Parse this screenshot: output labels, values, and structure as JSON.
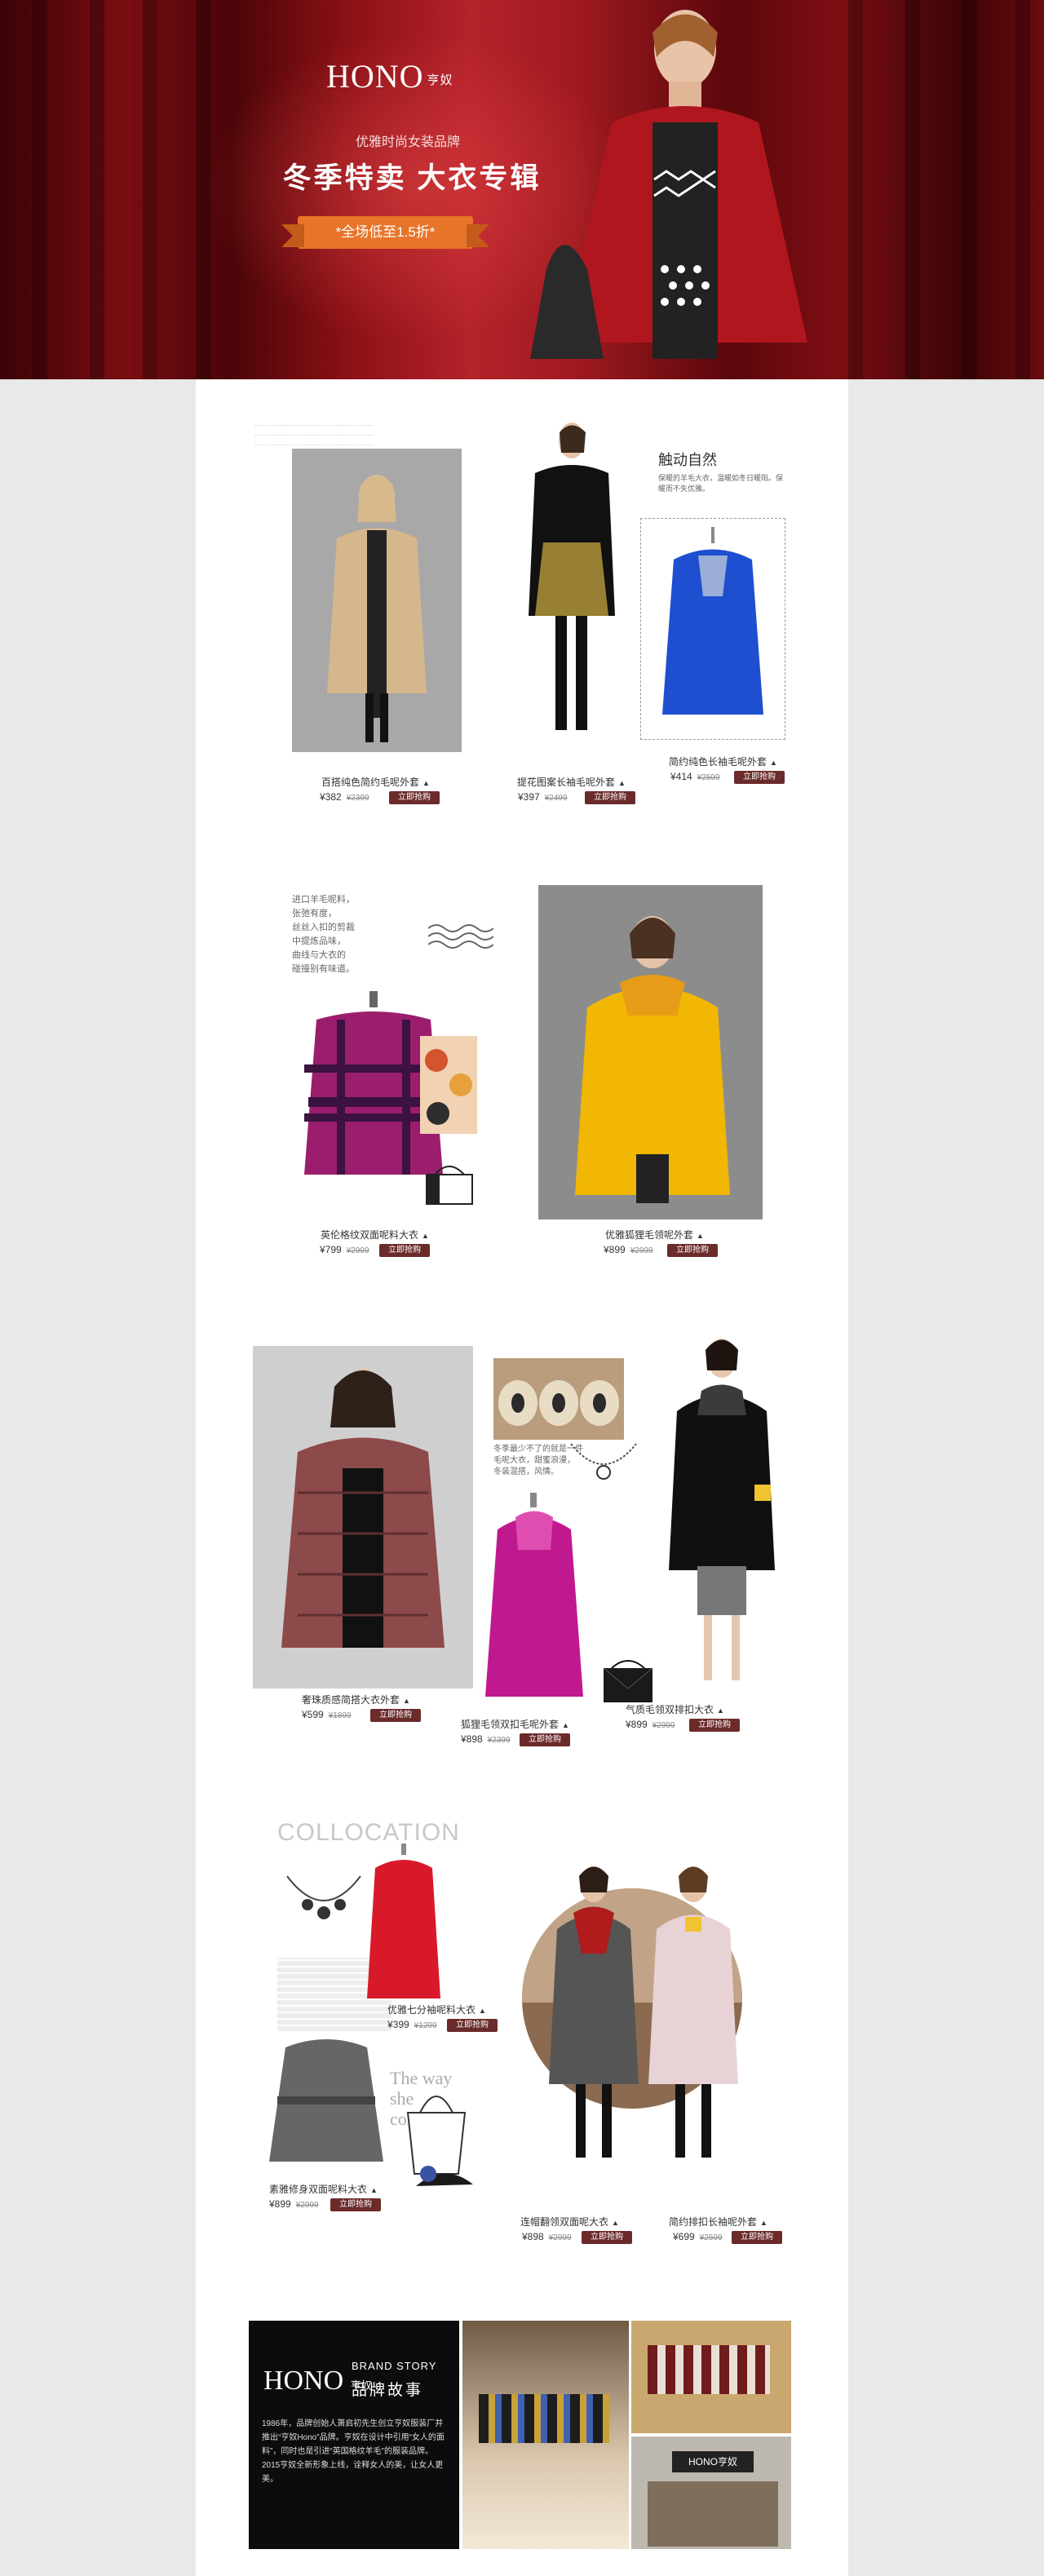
{
  "banner": {
    "logo": "HONO",
    "logo_cn": "亨奴",
    "tagline": "优雅时尚女装品牌",
    "title": "冬季特卖 大衣专辑",
    "promo": "*全场低至1.5折*"
  },
  "section1": {
    "heading": "触动自然",
    "desc": "保暖的羊毛大衣，温暖如冬日暖阳。保暖而不失优雅。",
    "items": [
      {
        "name": "百搭纯色简约毛呢外套",
        "price": "¥382",
        "old": "¥2399",
        "buy": "立即抢购"
      },
      {
        "name": "提花图案长袖毛呢外套",
        "price": "¥397",
        "old": "¥2499",
        "buy": "立即抢购"
      },
      {
        "name": "简约纯色长袖毛呢外套",
        "price": "¥414",
        "old": "¥2599",
        "buy": "立即抢购"
      }
    ]
  },
  "section2": {
    "desc": "进口羊毛呢料，\n张弛有度，\n丝丝入扣的剪裁\n中提炼品味，\n曲线与大衣的\n碰撞别有味道。",
    "items": [
      {
        "name": "英伦格纹双面呢料大衣",
        "price": "¥799",
        "old": "¥2999",
        "buy": "立即抢购"
      },
      {
        "name": "优雅狐狸毛领呢外套",
        "price": "¥899",
        "old": "¥2999",
        "buy": "立即抢购"
      }
    ]
  },
  "section3": {
    "desc": "冬季最少不了的就是一件\n毛呢大衣，甜蜜浪漫，\n冬装混搭，风情。",
    "items": [
      {
        "name": "奢珠质感简搭大衣外套",
        "price": "¥599",
        "old": "¥1899",
        "buy": "立即抢购"
      },
      {
        "name": "狐狸毛领双扣毛呢外套",
        "price": "¥898",
        "old": "¥2399",
        "buy": "立即抢购"
      },
      {
        "name": "气质毛领双排扣大衣",
        "price": "¥899",
        "old": "¥2999",
        "buy": "立即抢购"
      }
    ]
  },
  "section4": {
    "heading": "COLLOCATION",
    "script": "The way\nshe\ncollocai",
    "items": [
      {
        "name": "优雅七分袖呢料大衣",
        "price": "¥399",
        "old": "¥1299",
        "buy": "立即抢购"
      },
      {
        "name": "素雅修身双面呢料大衣",
        "price": "¥899",
        "old": "¥2999",
        "buy": "立即抢购"
      },
      {
        "name": "连帽翻领双面呢大衣",
        "price": "¥898",
        "old": "¥2999",
        "buy": "立即抢购"
      },
      {
        "name": "简约排扣长袖呢外套",
        "price": "¥699",
        "old": "¥2599",
        "buy": "立即抢购"
      }
    ]
  },
  "brand": {
    "logo": "HONO",
    "logo_cn": "亨奴",
    "label_en": "BRAND STORY",
    "label_cn": "品牌故事",
    "story": "1986年，品牌创始人萧启初先生创立亨奴服装厂并推出“亨奴Hono”品牌。亨奴在设计中引用“女人的面料”，同时也是引进“英国格纹羊毛”的服装品牌。2015亨奴全新形象上线，诠释女人的美，让女人更美。",
    "store_sign": "HONO亨奴"
  }
}
